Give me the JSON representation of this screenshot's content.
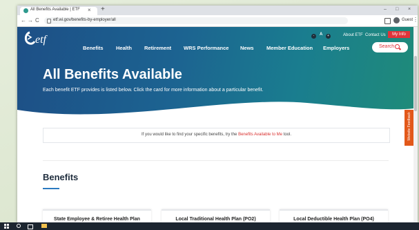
{
  "browser": {
    "tab_title": "All Benefits Available | ETF",
    "tab_close": "×",
    "new_tab": "+",
    "win_min": "–",
    "win_max": "□",
    "win_close": "×",
    "back": "←",
    "forward": "→",
    "reload": "C",
    "url": "etf.wi.gov/benefits-by-employer/all",
    "profile_label": "Guest",
    "menu": "⋮"
  },
  "site": {
    "utility": {
      "a_label": "A",
      "about": "About ETF",
      "contact": "Contact Us",
      "my_info": "My Info"
    },
    "nav": [
      "Benefits",
      "Health",
      "Retirement",
      "WRS Performance",
      "News",
      "Member Education",
      "Employers"
    ],
    "search_label": "Search",
    "hero": {
      "title": "All Benefits Available",
      "subtitle": "Each benefit ETF provides is listed below. Click the card for more information about a particular benefit."
    },
    "feedback": "Website Feedback",
    "notice": {
      "before": "If you would like to find your specific benefits, try the ",
      "link": "Benefits Available to Me",
      "after": " tool."
    },
    "section_title": "Benefits",
    "cards": [
      "State Employee & Retiree Health Plan",
      "Local Traditional Health Plan (PO2)",
      "Local Deductible Health Plan (PO4)"
    ]
  },
  "colors": {
    "brand_blue": "#1d4f86",
    "brand_teal": "#1f8b79",
    "accent_red": "#e0333a",
    "feedback_orange": "#e2581a"
  },
  "icons": [
    "etf-logo",
    "lock-icon",
    "search-icon",
    "profile-icon",
    "extension-icon",
    "windows-start-icon",
    "file-explorer-icon"
  ]
}
